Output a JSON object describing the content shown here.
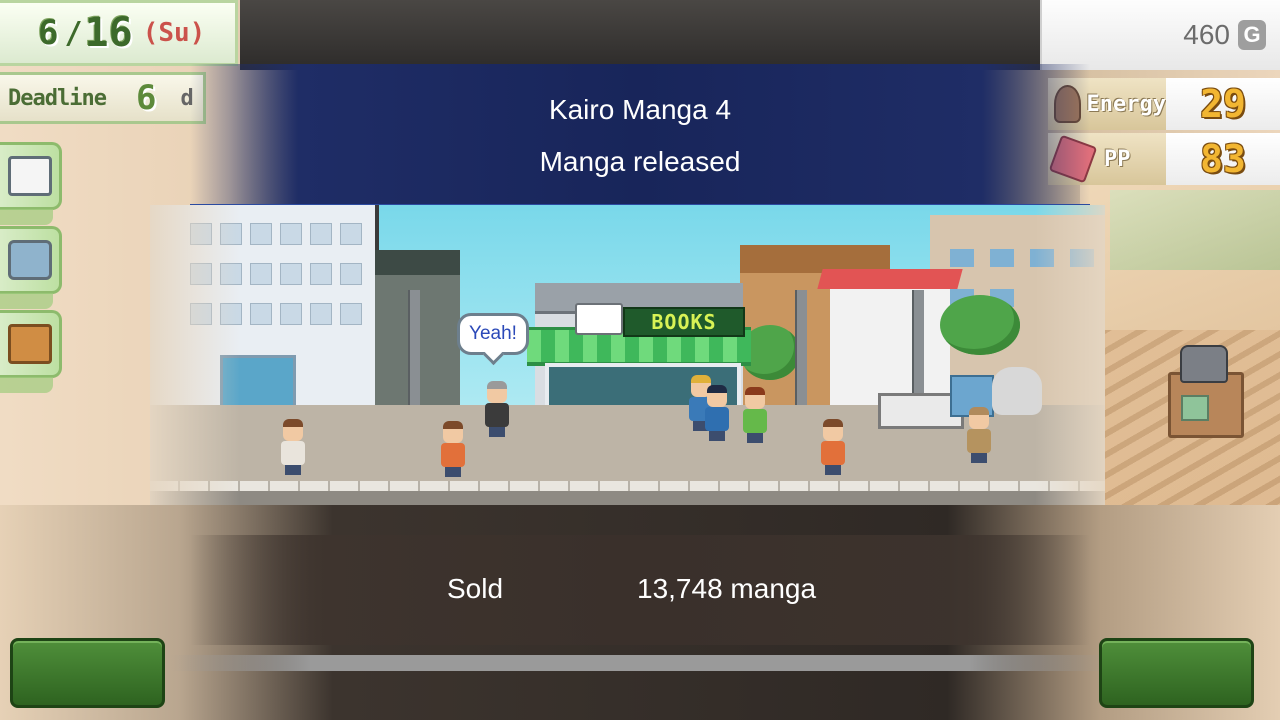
{
  "hud": {
    "date": {
      "month": "6",
      "day": "16",
      "weekday": "(Su)"
    },
    "money": {
      "value": "460",
      "currency_symbol": "G"
    },
    "deadline": {
      "label": "Deadline",
      "value": "6",
      "unit": "d"
    },
    "energy": {
      "label": "Energy",
      "value": "29",
      "icon": "energy-icon"
    },
    "pp": {
      "label": "PP",
      "value": "83",
      "icon": "pp-icon"
    }
  },
  "side_menu": [
    {
      "icon": "notepad-icon"
    },
    {
      "icon": "camera-icon"
    },
    {
      "icon": "briefcase-icon"
    }
  ],
  "notification": {
    "title": "Kairo Manga 4",
    "subtitle": "Manga released"
  },
  "scene": {
    "shop_sign": "BOOKS",
    "speech_bubble": "Yeah!"
  },
  "result": {
    "label": "Sold",
    "value": "13,748 manga"
  },
  "colors": {
    "banner": "#18255a",
    "button_green": "#2e6320",
    "stat_value": "#f2b632"
  }
}
